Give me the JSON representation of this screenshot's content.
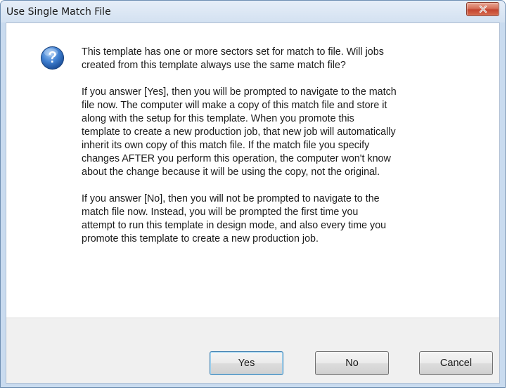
{
  "window": {
    "title": "Use Single Match File"
  },
  "icons": {
    "dialog_icon": "question-icon",
    "close": "close-icon"
  },
  "colors": {
    "close_button": "#c7513b",
    "question_icon": "#2f67b3",
    "button_bar": "#f0f0f0"
  },
  "message": {
    "paragraphs": [
      "This template has one or more sectors set for match to file.  Will jobs\ncreated from this template always use the same match file?",
      "If you answer [Yes], then you will be prompted to navigate to the match\nfile now.  The computer will make a copy of this match file and store it\nalong with the setup for this template.  When you promote this\ntemplate to create a new production job, that new job will automatically\ninherit its own copy of this match file.  If the match file you specify\nchanges AFTER you perform this operation, the computer won't know\nabout the change because it will be using the copy, not the original.",
      "If you answer [No], then you will not be prompted to navigate to the\nmatch file now.  Instead, you will be prompted the first time you\nattempt to run this template in design mode, and also every time you\npromote this template to create a new production job."
    ]
  },
  "buttons": {
    "yes": "Yes",
    "no": "No",
    "cancel": "Cancel"
  }
}
